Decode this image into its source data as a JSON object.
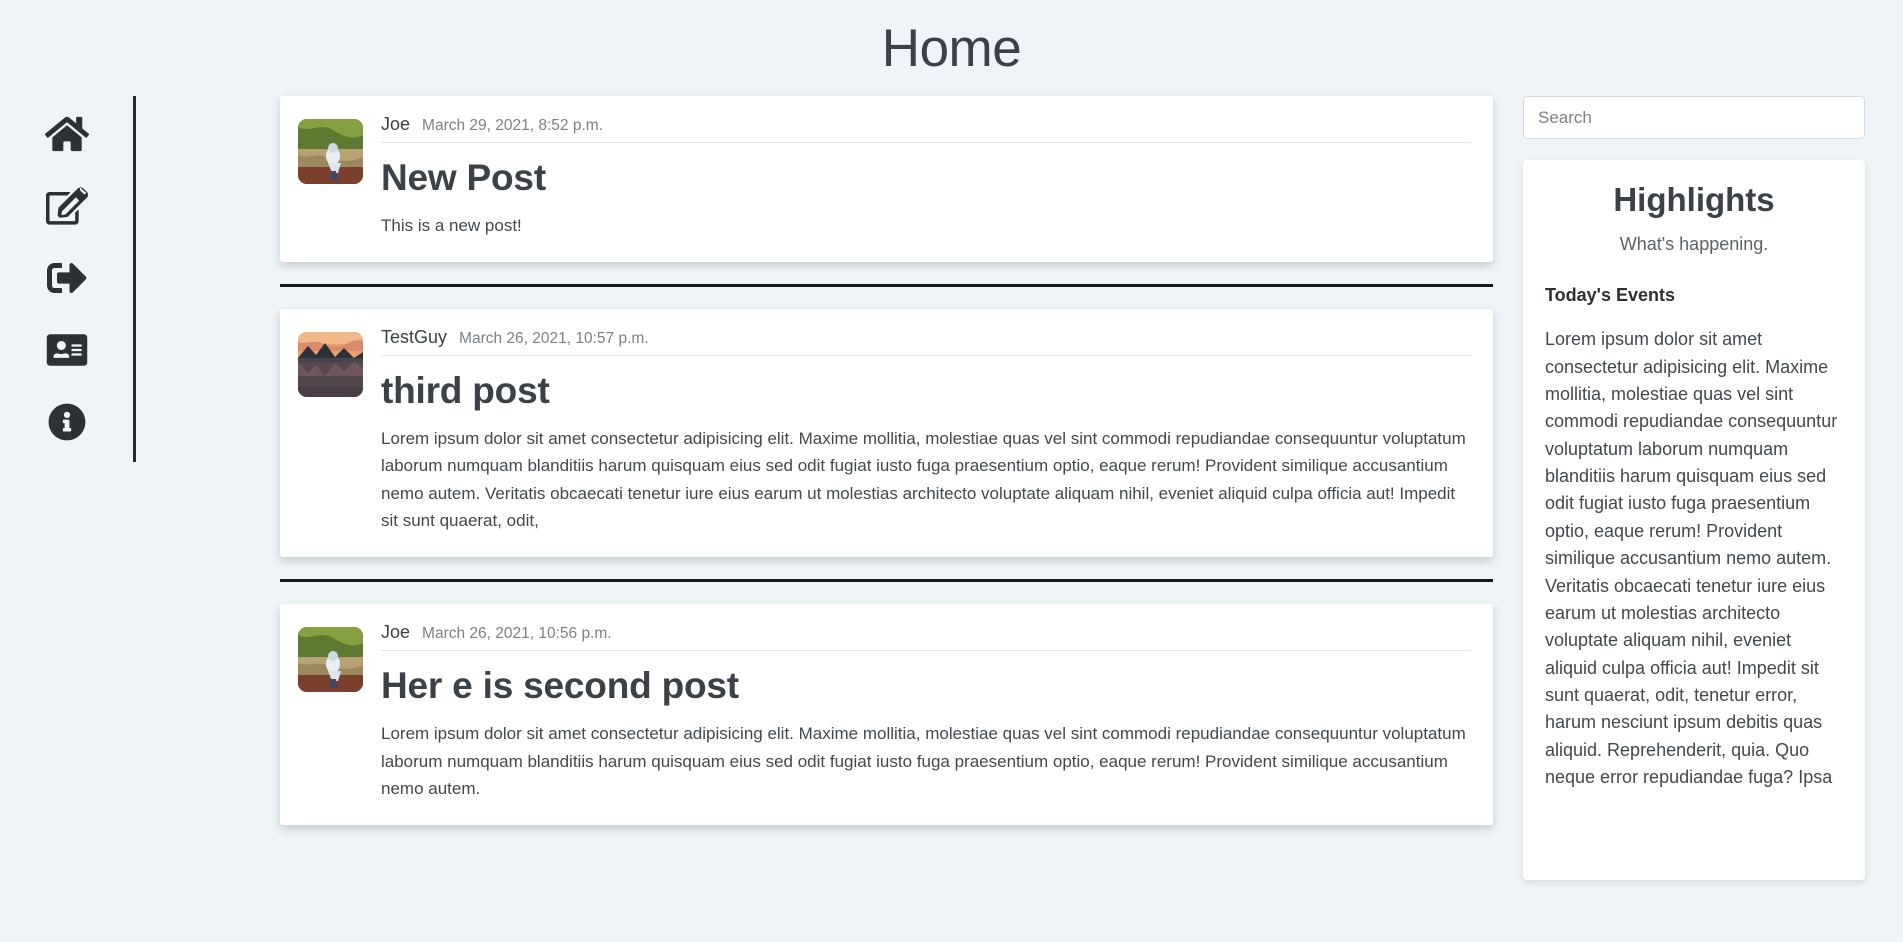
{
  "header": {
    "title": "Home"
  },
  "sidebar": {
    "items": [
      {
        "icon": "home-icon",
        "name": "sidebar-item-home"
      },
      {
        "icon": "edit-post-icon",
        "name": "sidebar-item-new-post"
      },
      {
        "icon": "logout-icon",
        "name": "sidebar-item-logout"
      },
      {
        "icon": "profile-card-icon",
        "name": "sidebar-item-profile"
      },
      {
        "icon": "info-circle-icon",
        "name": "sidebar-item-about"
      }
    ]
  },
  "feed": {
    "posts": [
      {
        "author": "Joe",
        "date": "March 29, 2021, 8:52 p.m.",
        "title": "New Post",
        "text": "This is a new post!",
        "avatar": "avatar-joe"
      },
      {
        "author": "TestGuy",
        "date": "March 26, 2021, 10:57 p.m.",
        "title": "third post",
        "text": "Lorem ipsum dolor sit amet consectetur adipisicing elit. Maxime mollitia, molestiae quas vel sint commodi repudiandae consequuntur voluptatum laborum numquam blanditiis harum quisquam eius sed odit fugiat iusto fuga praesentium optio, eaque rerum! Provident similique accusantium nemo autem. Veritatis obcaecati tenetur iure eius earum ut molestias architecto voluptate aliquam nihil, eveniet aliquid culpa officia aut! Impedit sit sunt quaerat, odit,",
        "avatar": "avatar-testguy"
      },
      {
        "author": "Joe",
        "date": "March 26, 2021, 10:56 p.m.",
        "title": "Her e is second post",
        "text": "Lorem ipsum dolor sit amet consectetur adipisicing elit. Maxime mollitia, molestiae quas vel sint commodi repudiandae consequuntur voluptatum laborum numquam blanditiis harum quisquam eius sed odit fugiat iusto fuga praesentium optio, eaque rerum! Provident similique accusantium nemo autem.",
        "avatar": "avatar-joe"
      }
    ]
  },
  "search": {
    "placeholder": "Search",
    "value": ""
  },
  "highlights": {
    "title": "Highlights",
    "subtitle": "What's happening.",
    "section_heading": "Today's Events",
    "body": "Lorem ipsum dolor sit amet consectetur adipisicing elit. Maxime mollitia, molestiae quas vel sint commodi repudiandae consequuntur voluptatum laborum numquam blanditiis harum quisquam eius sed odit fugiat iusto fuga praesentium optio, eaque rerum! Provident similique accusantium nemo autem. Veritatis obcaecati tenetur iure eius earum ut molestias architecto voluptate aliquam nihil, eveniet aliquid culpa officia aut! Impedit sit sunt quaerat, odit, tenetur error, harum nesciunt ipsum debitis quas aliquid. Reprehenderit, quia. Quo neque error repudiandae fuga? Ipsa"
  },
  "colors": {
    "page_background": "#eef4f7",
    "card_background": "#ffffff",
    "text_primary": "#3b4146",
    "text_muted": "#7b8185",
    "rule": "#16191c"
  }
}
